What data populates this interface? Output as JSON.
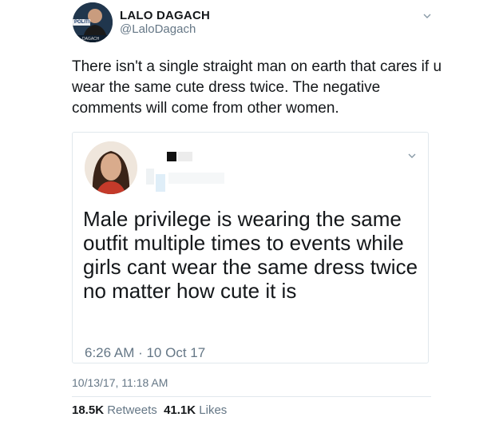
{
  "author": {
    "name": "LALO DAGACH",
    "handle": "@LaloDagach",
    "avatar_badge": "POLITI",
    "avatar_caption": "DAGACH"
  },
  "tweet": {
    "text": "There isn't a single straight man on earth that cares if u wear the same cute dress twice. The negative comments will come from other women.",
    "timestamp": "10/13/17, 11:18 AM"
  },
  "quoted": {
    "text": "Male privilege is wearing the same outfit multiple times to events while girls cant wear the same dress twice  no matter how cute it is",
    "time": "6:26 AM · 10 Oct 17"
  },
  "stats": {
    "retweets_count": "18.5K",
    "retweets_label": "Retweets",
    "likes_count": "41.1K",
    "likes_label": "Likes"
  },
  "icons": [
    "chevron-down-icon"
  ]
}
